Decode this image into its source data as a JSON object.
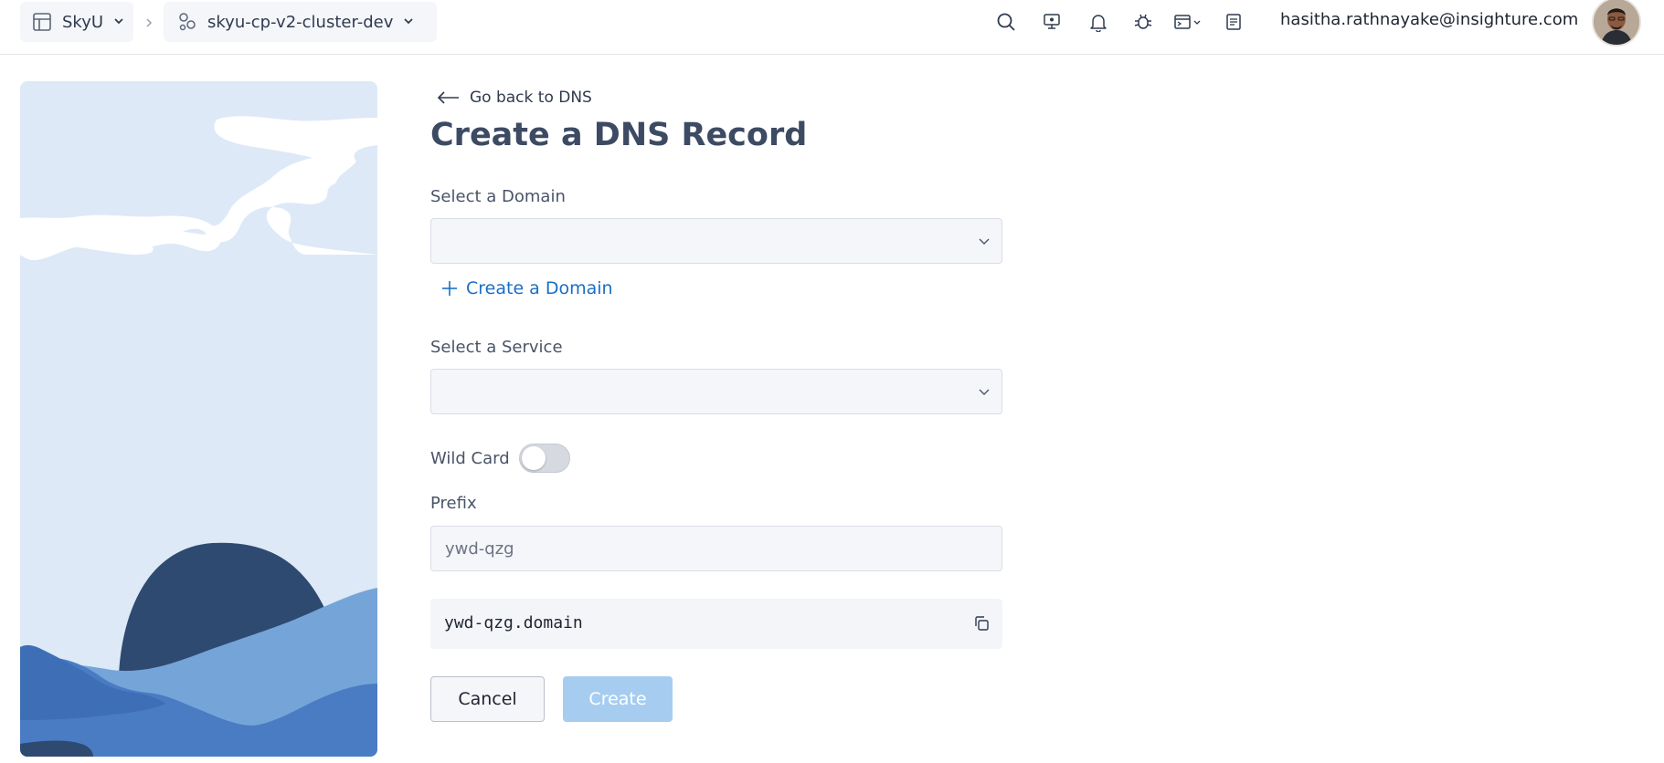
{
  "topbar": {
    "workspace_label": "SkyU",
    "project_label": "skyu-cp-v2-cluster-dev",
    "user_email": "hasitha.rathnayake@insighture.com",
    "icons": [
      "layout-icon",
      "chevron-down-icon",
      "chevron-right-icon",
      "cluster-icon",
      "search-icon",
      "monitor-icon",
      "bell-icon",
      "bug-icon",
      "terminal-icon",
      "document-icon",
      "avatar"
    ]
  },
  "form": {
    "back_label": "Go back to DNS",
    "title": "Create a DNS Record",
    "domain_label": "Select a Domain",
    "domain_value": "",
    "create_domain_label": "Create a Domain",
    "service_label": "Select a Service",
    "service_value": "",
    "wildcard_label": "Wild Card",
    "wildcard_enabled": false,
    "prefix_label": "Prefix",
    "prefix_value": "ywd-qzg",
    "result_value": "ywd-qzg.domain",
    "cancel_label": "Cancel",
    "create_label": "Create"
  },
  "colors": {
    "accent": "#1a6fc4",
    "create_button_disabled": "#a6cdf0",
    "illustration_sky": "#dde9f7",
    "illustration_dark": "#2e4a70",
    "illustration_mid": "#4a7cc4",
    "illustration_light": "#75a5d8"
  }
}
